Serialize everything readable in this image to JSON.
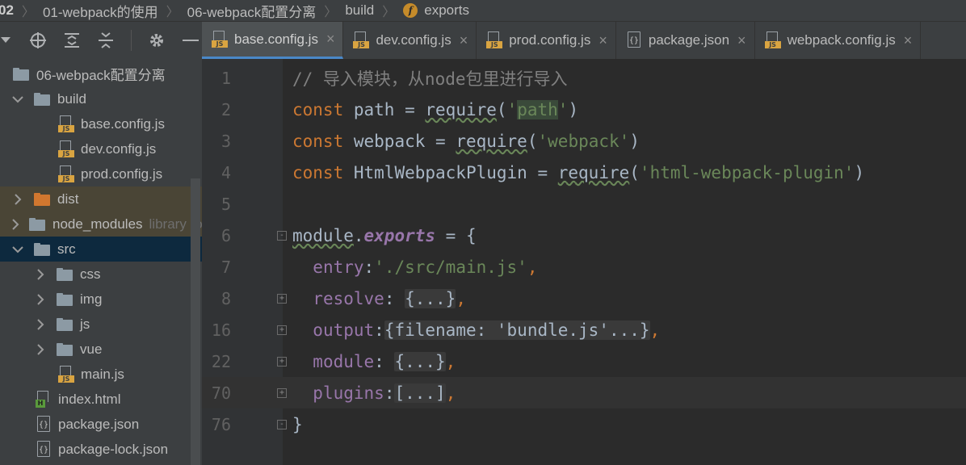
{
  "breadcrumb": {
    "items": [
      "02",
      "01-webpack的使用",
      "06-webpack配置分离",
      "build",
      "exports"
    ]
  },
  "tabs": [
    {
      "label": "base.config.js",
      "type": "js",
      "active": true
    },
    {
      "label": "dev.config.js",
      "type": "js",
      "active": false
    },
    {
      "label": "prod.config.js",
      "type": "js",
      "active": false
    },
    {
      "label": "package.json",
      "type": "json",
      "active": false
    },
    {
      "label": "webpack.config.js",
      "type": "js",
      "active": false
    }
  ],
  "tab_close_glyph": "×",
  "tree": {
    "root": "06-webpack配置分离",
    "build": "build",
    "base": "base.config.js",
    "dev": "dev.config.js",
    "prod": "prod.config.js",
    "dist": "dist",
    "node_modules": "node_modules",
    "node_modules_tag": "library root",
    "src": "src",
    "css": "css",
    "img": "img",
    "js": "js",
    "vue": "vue",
    "main": "main.js",
    "index": "index.html",
    "package": "package.json",
    "package_lock": "package-lock.json"
  },
  "editor": {
    "lines": [
      {
        "n": "1"
      },
      {
        "n": "2"
      },
      {
        "n": "3"
      },
      {
        "n": "4"
      },
      {
        "n": "5"
      },
      {
        "n": "6"
      },
      {
        "n": "7"
      },
      {
        "n": "8"
      },
      {
        "n": "16"
      },
      {
        "n": "22"
      },
      {
        "n": "70"
      },
      {
        "n": "76"
      }
    ],
    "comment": "// 导入模块，从node包里进行导入",
    "const": "const",
    "path_var": "path",
    "webpack_var": "webpack",
    "html_var": "HtmlWebpackPlugin",
    "eq": " = ",
    "require": "require",
    "path_str": "path",
    "webpack_str": "webpack",
    "html_str": "html-webpack-plugin",
    "module": "module",
    "exports": "exports",
    "entry": "entry",
    "entry_val": "'./src/main.js'",
    "resolve": "resolve",
    "output": "output",
    "output_val": "{filename: 'bundle.js'...}",
    "module_key": "module",
    "plugins": "plugins",
    "folded_obj": "{...}",
    "folded_arr": "[...]"
  },
  "colors": {
    "accent": "#4a88c7",
    "keyword": "#cc7832",
    "string": "#6a8759",
    "property": "#9876aa"
  }
}
